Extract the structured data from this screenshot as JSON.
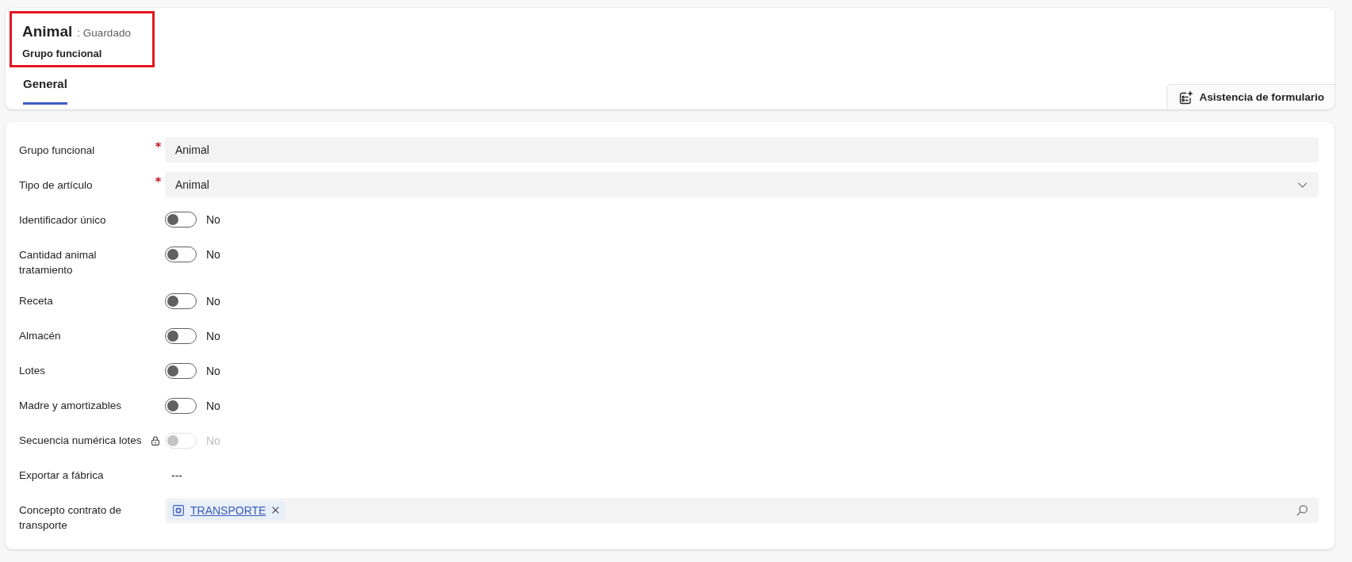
{
  "header": {
    "title": "Animal",
    "status": ": Guardado",
    "subtitle": "Grupo funcional",
    "highlighted": true
  },
  "tabs": [
    {
      "label": "General",
      "selected": true
    }
  ],
  "form_assist_button": {
    "label": "Asistencia de formulario"
  },
  "fields": [
    {
      "kind": "text",
      "label": "Grupo funcional",
      "required": true,
      "locked": false,
      "disabled": false,
      "value": "Animal"
    },
    {
      "kind": "select",
      "label": "Tipo de artículo",
      "required": true,
      "locked": false,
      "disabled": false,
      "value": "Animal"
    },
    {
      "kind": "toggle",
      "label": "Identificador único",
      "required": false,
      "locked": false,
      "disabled": false,
      "on": false,
      "value": "No"
    },
    {
      "kind": "toggle",
      "label": "Cantidad animal tratamiento",
      "required": false,
      "locked": false,
      "disabled": false,
      "on": false,
      "value": "No"
    },
    {
      "kind": "toggle",
      "label": "Receta",
      "required": false,
      "locked": false,
      "disabled": false,
      "on": false,
      "value": "No"
    },
    {
      "kind": "toggle",
      "label": "Almacén",
      "required": false,
      "locked": false,
      "disabled": false,
      "on": false,
      "value": "No"
    },
    {
      "kind": "toggle",
      "label": "Lotes",
      "required": false,
      "locked": false,
      "disabled": false,
      "on": false,
      "value": "No"
    },
    {
      "kind": "toggle",
      "label": "Madre y amortizables",
      "required": false,
      "locked": false,
      "disabled": false,
      "on": false,
      "value": "No"
    },
    {
      "kind": "toggle",
      "label": "Secuencia numérica lotes",
      "required": false,
      "locked": true,
      "disabled": true,
      "on": false,
      "value": "No"
    },
    {
      "kind": "readonly",
      "label": "Exportar a fábrica",
      "required": false,
      "locked": false,
      "disabled": false,
      "value": "---"
    },
    {
      "kind": "lookup",
      "label": "Concepto contrato de transporte",
      "required": false,
      "locked": false,
      "disabled": false,
      "tags": [
        {
          "label": "TRANSPORTE"
        }
      ]
    }
  ]
}
